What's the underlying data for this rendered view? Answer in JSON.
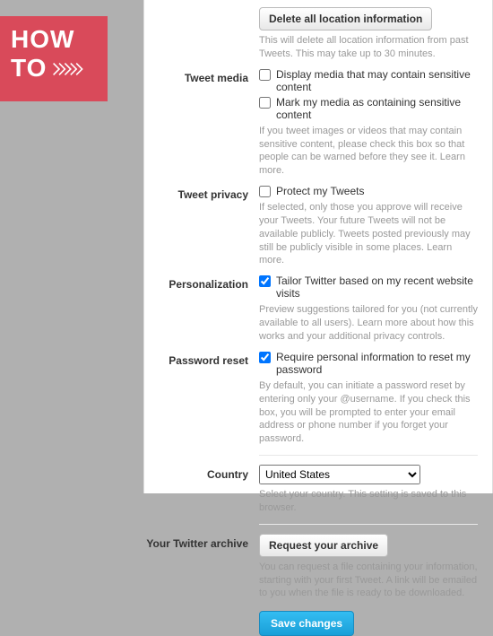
{
  "badge": {
    "line1": "HOW",
    "line2": "TO"
  },
  "location": {
    "delete_btn": "Delete all location information",
    "help": "This will delete all location information from past Tweets. This may take up to 30 minutes."
  },
  "media": {
    "label": "Tweet media",
    "opt1": "Display media that may contain sensitive content",
    "opt2": "Mark my media as containing sensitive content",
    "help": "If you tweet images or videos that may contain sensitive content, please check this box so that people can be warned before they see it. Learn more."
  },
  "privacy": {
    "label": "Tweet privacy",
    "opt": "Protect my Tweets",
    "help": "If selected, only those you approve will receive your Tweets. Your future Tweets will not be available publicly. Tweets posted previously may still be publicly visible in some places. Learn more."
  },
  "personalization": {
    "label": "Personalization",
    "opt": "Tailor Twitter based on my recent website visits",
    "help": "Preview suggestions tailored for you (not currently available to all users). Learn more about how this works and your additional privacy controls."
  },
  "password": {
    "label": "Password reset",
    "opt": "Require personal information to reset my password",
    "help": "By default, you can initiate a password reset by entering only your @username. If you check this box, you will be prompted to enter your email address or phone number if you forget your password."
  },
  "country": {
    "label": "Country",
    "value": "United States",
    "help": "Select your country. This setting is saved to this browser."
  },
  "archive": {
    "label": "Your Twitter archive",
    "btn": "Request your archive",
    "help": "You can request a file containing your information, starting with your first Tweet. A link will be emailed to you when the file is ready to be downloaded."
  },
  "save": {
    "label": "Save changes"
  }
}
